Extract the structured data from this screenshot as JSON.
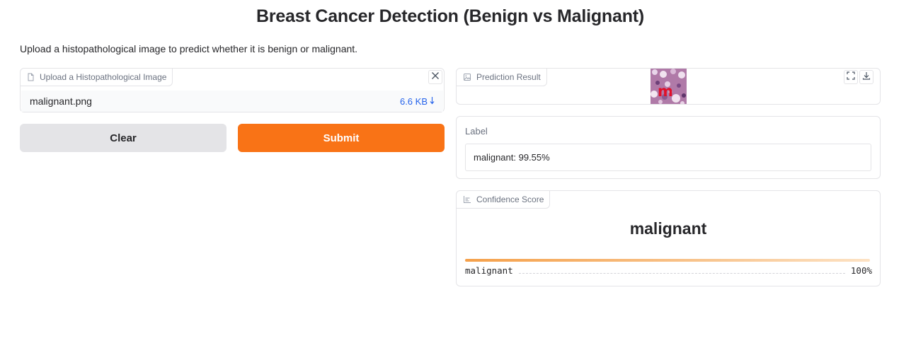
{
  "page": {
    "title": "Breast Cancer Detection (Benign vs Malignant)",
    "description": "Upload a histopathological image to predict whether it is benign or malignant."
  },
  "upload": {
    "label": "Upload a Histopathological Image",
    "file_name": "malignant.png",
    "file_size": "6.6 KB",
    "icons": {
      "label": "file-icon",
      "close": "close-icon",
      "download": "download-arrow-icon"
    }
  },
  "buttons": {
    "clear": "Clear",
    "submit": "Submit"
  },
  "prediction": {
    "label": "Prediction Result",
    "icons": {
      "label": "image-icon",
      "fullscreen": "fullscreen-icon",
      "download": "download-icon"
    }
  },
  "label_output": {
    "title": "Label",
    "value": "malignant: 99.55%"
  },
  "confidence": {
    "label": "Confidence Score",
    "heading": "malignant",
    "rows": [
      {
        "name": "malignant",
        "value": "100%",
        "fraction": 1.0
      }
    ],
    "icons": {
      "label": "chart-icon"
    }
  },
  "colors": {
    "accent": "#f97316",
    "link": "#2563eb",
    "secondary_button": "#e4e4e7",
    "border": "#e4e4e7"
  }
}
